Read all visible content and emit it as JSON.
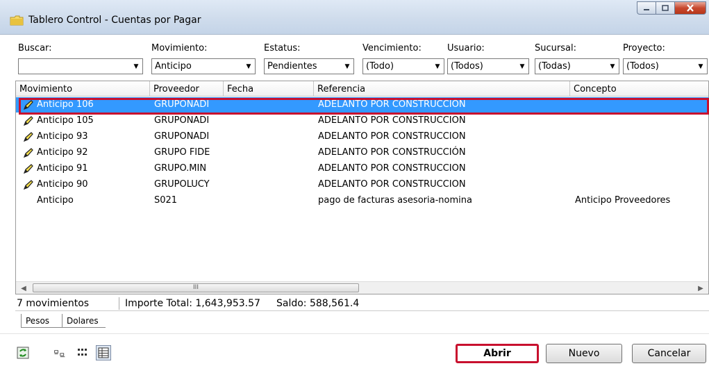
{
  "window": {
    "title": "Tablero Control - Cuentas por Pagar"
  },
  "filters": [
    {
      "label": "Buscar:",
      "value": ""
    },
    {
      "label": "Movimiento:",
      "value": "Anticipo"
    },
    {
      "label": "Estatus:",
      "value": "Pendientes"
    },
    {
      "label": "Vencimiento:",
      "value": "(Todo)"
    },
    {
      "label": "Usuario:",
      "value": "(Todos)"
    },
    {
      "label": "Sucursal:",
      "value": "(Todas)"
    },
    {
      "label": "Proyecto:",
      "value": "(Todos)"
    }
  ],
  "grid": {
    "columns": [
      "Movimiento",
      "Proveedor",
      "Fecha",
      "Referencia",
      "Concepto"
    ],
    "rows": [
      {
        "movimiento": "Anticipo 106",
        "proveedor": "GRUPONADI",
        "fecha": "",
        "referencia": "ADELANTO POR CONSTRUCCION",
        "concepto": "",
        "icon": "pencil-icon",
        "selected": true
      },
      {
        "movimiento": "Anticipo 105",
        "proveedor": "GRUPONADI",
        "fecha": "",
        "referencia": "ADELANTO POR CONSTRUCCION",
        "concepto": "",
        "icon": "pencil-icon",
        "selected": false
      },
      {
        "movimiento": "Anticipo 93",
        "proveedor": "GRUPONADI",
        "fecha": "",
        "referencia": "ADELANTO POR CONSTRUCCION",
        "concepto": "",
        "icon": "pencil-icon",
        "selected": false
      },
      {
        "movimiento": "Anticipo 92",
        "proveedor": "GRUPO FIDE",
        "fecha": "",
        "referencia": "ADELANTO POR CONSTRUCCIÓN",
        "concepto": "",
        "icon": "pencil-icon",
        "selected": false
      },
      {
        "movimiento": "Anticipo 91",
        "proveedor": "GRUPO.MIN",
        "fecha": "",
        "referencia": "ADELANTO POR CONSTRUCCION",
        "concepto": "",
        "icon": "pencil-icon",
        "selected": false
      },
      {
        "movimiento": "Anticipo 90",
        "proveedor": "GRUPOLUCY",
        "fecha": "",
        "referencia": "ADELANTO POR CONSTRUCCION",
        "concepto": "",
        "icon": "pencil-icon",
        "selected": false
      },
      {
        "movimiento": "Anticipo",
        "proveedor": "S021",
        "fecha": "",
        "referencia": "pago de facturas asesoria-nomina",
        "concepto": "Anticipo Proveedores",
        "icon": "",
        "selected": false
      }
    ]
  },
  "status": {
    "count": "7 movimientos",
    "total": "Importe Total: 1,643,953.57",
    "saldo": "Saldo: 588,561.4"
  },
  "tabs": [
    "Pesos",
    "Dolares"
  ],
  "buttons": {
    "abrir": "Abrir",
    "nuevo": "Nuevo",
    "cancelar": "Cancelar"
  },
  "colors": {
    "selection": "#3399ff",
    "highlight": "#c8102e"
  }
}
